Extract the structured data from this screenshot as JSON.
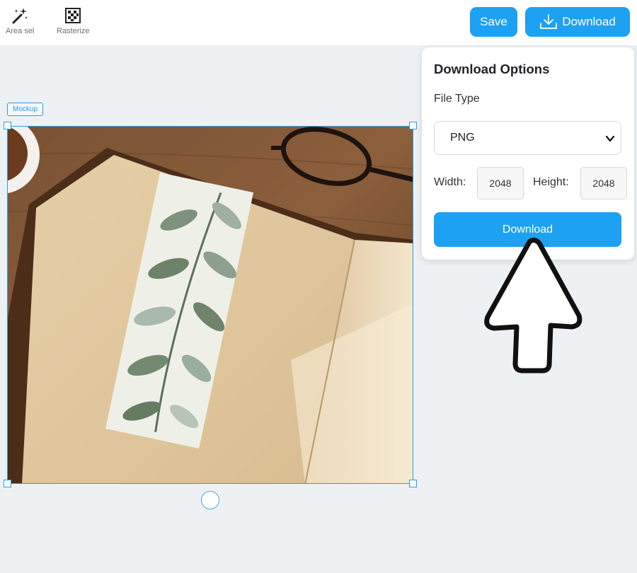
{
  "toolbar": {
    "area_sel_label": "Area sel",
    "rasterize_label": "Rasterize",
    "save_label": "Save",
    "download_label": "Download"
  },
  "canvas": {
    "mockup_tag": "Mockup"
  },
  "download_panel": {
    "title": "Download Options",
    "file_type_label": "File Type",
    "file_type_value": "PNG",
    "width_label": "Width:",
    "width_value": "2048",
    "height_label": "Height:",
    "height_value": "2048",
    "download_label": "Download"
  },
  "colors": {
    "accent": "#1da1f2",
    "selection": "#2d9be5"
  }
}
